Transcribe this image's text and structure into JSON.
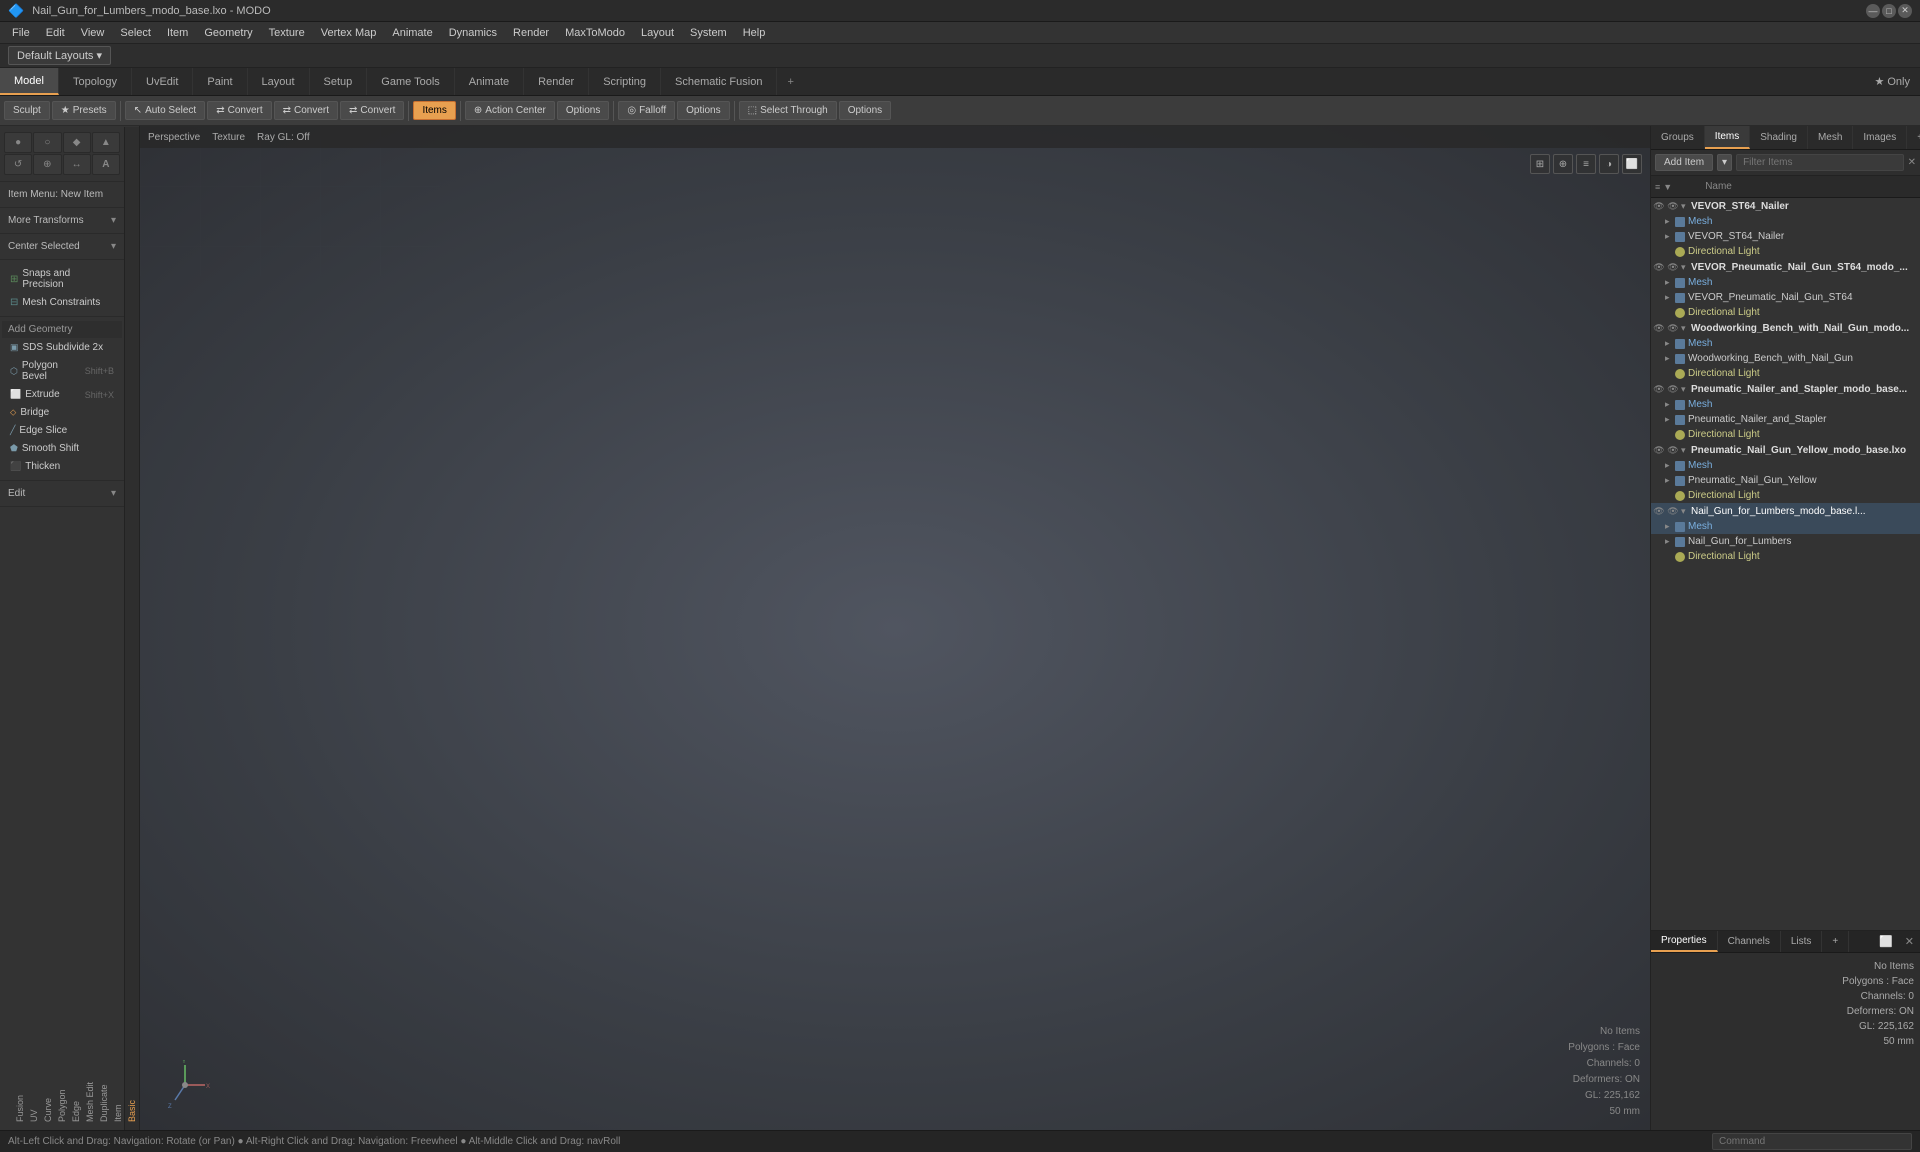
{
  "window": {
    "title": "Nail_Gun_for_Lumbers_modo_base.lxo - MODO"
  },
  "menubar": {
    "items": [
      "File",
      "Edit",
      "View",
      "Select",
      "Item",
      "Geometry",
      "Texture",
      "Vertex Map",
      "Animate",
      "Dynamics",
      "Render",
      "MaxToModo",
      "Layout",
      "System",
      "Help"
    ]
  },
  "layoutbar": {
    "layout_label": "Default Layouts ▾"
  },
  "tabbar": {
    "tabs": [
      "Model",
      "Topology",
      "UvEdit",
      "Paint",
      "Layout",
      "Setup",
      "Game Tools",
      "Animate",
      "Render",
      "Scripting",
      "Schematic Fusion"
    ],
    "active": "Model",
    "star_label": "★  Only"
  },
  "toolbar": {
    "sculpt_label": "Sculpt",
    "presets_label": "Presets",
    "presets_icon": "★",
    "auto_select_label": "Auto Select",
    "convert_labels": [
      "Convert",
      "Convert",
      "Convert"
    ],
    "items_label": "Items",
    "action_center_label": "Action Center",
    "options_label": "Options",
    "falloff_label": "Falloff",
    "options2_label": "Options",
    "select_through_label": "Select Through",
    "options3_label": "Options"
  },
  "viewport": {
    "mode": "Perspective",
    "texture": "Texture",
    "ray": "Ray GL: Off"
  },
  "left_sidebar": {
    "icon_buttons": [
      "●",
      "○",
      "◆",
      "▲",
      "↺",
      "⊕",
      "↔",
      "A"
    ],
    "item_menu": "Item Menu: New Item",
    "more_transforms": "More Transforms",
    "center_selected": "Center Selected",
    "snaps": "Snaps and Precision",
    "mesh_constraints": "Mesh Constraints",
    "add_geometry": "Add Geometry",
    "tools": [
      {
        "label": "SDS Subdivide 2x",
        "shortcut": ""
      },
      {
        "label": "Polygon Bevel",
        "shortcut": "Shift+B"
      },
      {
        "label": "Extrude",
        "shortcut": "Shift+X"
      },
      {
        "label": "Bridge",
        "shortcut": ""
      },
      {
        "label": "Edge Slice",
        "shortcut": ""
      },
      {
        "label": "Smooth Shift",
        "shortcut": ""
      },
      {
        "label": "Thicken",
        "shortcut": ""
      }
    ],
    "edit_label": "Edit",
    "vtabs": [
      "Basic",
      "Item",
      "Duplicate",
      "Mesh Edit",
      "Edge",
      "Polygon",
      "Curve",
      "UV",
      "Fusion"
    ]
  },
  "items_panel": {
    "add_item_label": "Add Item",
    "add_item_dropdown": "▾",
    "filter_placeholder": "Filter Items",
    "col_name": "Name",
    "items": [
      {
        "level": 0,
        "type": "group",
        "name": "VEVOR_ST64_Nailer",
        "expanded": true
      },
      {
        "level": 1,
        "type": "mesh",
        "name": "Mesh",
        "expanded": false
      },
      {
        "level": 1,
        "type": "mesh",
        "name": "VEVOR_ST64_Nailer",
        "expanded": false
      },
      {
        "level": 1,
        "type": "light",
        "name": "Directional Light",
        "expanded": false
      },
      {
        "level": 0,
        "type": "group",
        "name": "VEVOR_Pneumatic_Nail_Gun_ST64_modo_...",
        "expanded": true
      },
      {
        "level": 1,
        "type": "mesh",
        "name": "Mesh",
        "expanded": false
      },
      {
        "level": 1,
        "type": "mesh",
        "name": "VEVOR_Pneumatic_Nail_Gun_ST64",
        "expanded": false
      },
      {
        "level": 1,
        "type": "light",
        "name": "Directional Light",
        "expanded": false
      },
      {
        "level": 0,
        "type": "group",
        "name": "Woodworking_Bench_with_Nail_Gun_modo...",
        "expanded": true
      },
      {
        "level": 1,
        "type": "mesh",
        "name": "Mesh",
        "expanded": false
      },
      {
        "level": 1,
        "type": "mesh",
        "name": "Woodworking_Bench_with_Nail_Gun",
        "expanded": false
      },
      {
        "level": 1,
        "type": "light",
        "name": "Directional Light",
        "expanded": false
      },
      {
        "level": 0,
        "type": "group",
        "name": "Pneumatic_Nailer_and_Stapler_modo_base...",
        "expanded": true
      },
      {
        "level": 1,
        "type": "mesh",
        "name": "Mesh",
        "expanded": false
      },
      {
        "level": 1,
        "type": "mesh",
        "name": "Pneumatic_Nailer_and_Stapler",
        "expanded": false
      },
      {
        "level": 1,
        "type": "light",
        "name": "Directional Light",
        "expanded": false
      },
      {
        "level": 0,
        "type": "group",
        "name": "Pneumatic_Nail_Gun_Yellow_modo_base.lxo",
        "expanded": true
      },
      {
        "level": 1,
        "type": "mesh",
        "name": "Mesh",
        "expanded": false
      },
      {
        "level": 1,
        "type": "mesh",
        "name": "Pneumatic_Nail_Gun_Yellow",
        "expanded": false
      },
      {
        "level": 1,
        "type": "light",
        "name": "Directional Light",
        "expanded": false
      },
      {
        "level": 0,
        "type": "group",
        "name": "Nail_Gun_for_Lumbers_modo_base.l...",
        "expanded": true,
        "selected": true
      },
      {
        "level": 1,
        "type": "mesh",
        "name": "Mesh",
        "expanded": false
      },
      {
        "level": 1,
        "type": "mesh",
        "name": "Nail_Gun_for_Lumbers",
        "expanded": false
      },
      {
        "level": 1,
        "type": "light",
        "name": "Directional Light",
        "expanded": false
      }
    ]
  },
  "right_tabs": {
    "tabs": [
      "Groups",
      "Items",
      "Shading",
      "Mesh",
      "Images"
    ],
    "active": "Items",
    "add_icon": "+"
  },
  "props_tabs": {
    "tabs": [
      "Properties",
      "Channels",
      "Lists"
    ],
    "active": "Properties",
    "add_icon": "+"
  },
  "props_info": {
    "no_items": "No Items",
    "polygons": "Polygons : Face",
    "channels": "Channels: 0",
    "deformers": "Deformers: ON",
    "gl": "GL: 225,162",
    "size": "50 mm"
  },
  "statusbar": {
    "message": "Alt-Left Click and Drag: Navigation: Rotate (or Pan)  ●  Alt-Right Click and Drag: Navigation: Freewheel  ●  Alt-Middle Click and Drag: navRoll",
    "cmd_placeholder": "Command"
  }
}
